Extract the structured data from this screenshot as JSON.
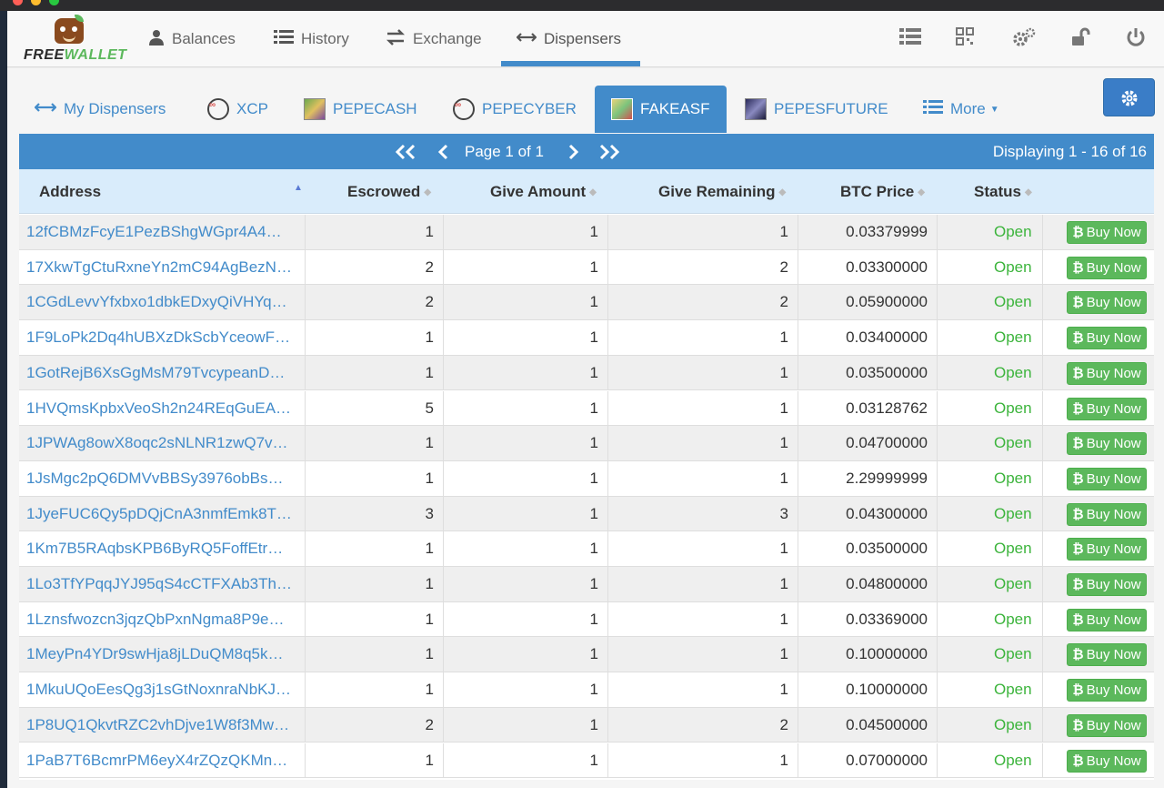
{
  "nav": {
    "logo_text_1": "FREE",
    "logo_text_2": "WALLET",
    "items": [
      {
        "label": "Balances",
        "icon": "user-icon"
      },
      {
        "label": "History",
        "icon": "list-icon"
      },
      {
        "label": "Exchange",
        "icon": "exchange-icon"
      },
      {
        "label": "Dispensers",
        "icon": "arrows-horizontal-icon"
      }
    ],
    "right_icons": [
      "list-icon",
      "qrcode-icon",
      "gears-icon",
      "unlock-icon",
      "power-icon"
    ]
  },
  "tabs": [
    {
      "label": "My Dispensers",
      "icon": "arrows-horizontal-icon"
    },
    {
      "label": "XCP",
      "icon": "xcp-token-icon"
    },
    {
      "label": "PEPECASH",
      "icon": "pepecash-token-icon"
    },
    {
      "label": "PEPECYBER",
      "icon": "pepecyber-token-icon"
    },
    {
      "label": "FAKEASF",
      "icon": "fakeasf-token-icon"
    },
    {
      "label": "PEPESFUTURE",
      "icon": "pepesfuture-token-icon"
    },
    {
      "label": "More",
      "icon": "list-icon"
    }
  ],
  "pager": {
    "page_text": "Page 1 of 1",
    "display_text": "Displaying 1 - 16 of 16"
  },
  "columns": [
    "Address",
    "Escrowed",
    "Give Amount",
    "Give Remaining",
    "BTC Price",
    "Status"
  ],
  "buy_label": "Buy Now",
  "rows": [
    {
      "address": "12fCBMzFcyE1PezBShgWGpr4A4…",
      "escrowed": "1",
      "give_amount": "1",
      "give_remaining": "1",
      "btc_price": "0.03379999",
      "status": "Open"
    },
    {
      "address": "17XkwTgCtuRxneYn2mC94AgBezN…",
      "escrowed": "2",
      "give_amount": "1",
      "give_remaining": "2",
      "btc_price": "0.03300000",
      "status": "Open"
    },
    {
      "address": "1CGdLevvYfxbxo1dbkEDxyQiVHYq…",
      "escrowed": "2",
      "give_amount": "1",
      "give_remaining": "2",
      "btc_price": "0.05900000",
      "status": "Open"
    },
    {
      "address": "1F9LoPk2Dq4hUBXzDkScbYceowF…",
      "escrowed": "1",
      "give_amount": "1",
      "give_remaining": "1",
      "btc_price": "0.03400000",
      "status": "Open"
    },
    {
      "address": "1GotRejB6XsGgMsM79TvcypeanD…",
      "escrowed": "1",
      "give_amount": "1",
      "give_remaining": "1",
      "btc_price": "0.03500000",
      "status": "Open"
    },
    {
      "address": "1HVQmsKpbxVeoSh2n24REqGuEA…",
      "escrowed": "5",
      "give_amount": "1",
      "give_remaining": "1",
      "btc_price": "0.03128762",
      "status": "Open"
    },
    {
      "address": "1JPWAg8owX8oqc2sNLNR1zwQ7v…",
      "escrowed": "1",
      "give_amount": "1",
      "give_remaining": "1",
      "btc_price": "0.04700000",
      "status": "Open"
    },
    {
      "address": "1JsMgc2pQ6DMVvBBSy3976obBs…",
      "escrowed": "1",
      "give_amount": "1",
      "give_remaining": "1",
      "btc_price": "2.29999999",
      "status": "Open"
    },
    {
      "address": "1JyeFUC6Qy5pDQjCnA3nmfEmk8T…",
      "escrowed": "3",
      "give_amount": "1",
      "give_remaining": "3",
      "btc_price": "0.04300000",
      "status": "Open"
    },
    {
      "address": "1Km7B5RAqbsKPB6ByRQ5FoffEtr…",
      "escrowed": "1",
      "give_amount": "1",
      "give_remaining": "1",
      "btc_price": "0.03500000",
      "status": "Open"
    },
    {
      "address": "1Lo3TfYPqqJYJ95qS4cCTFXAb3Th…",
      "escrowed": "1",
      "give_amount": "1",
      "give_remaining": "1",
      "btc_price": "0.04800000",
      "status": "Open"
    },
    {
      "address": "1Lznsfwozcn3jqzQbPxnNgma8P9e…",
      "escrowed": "1",
      "give_amount": "1",
      "give_remaining": "1",
      "btc_price": "0.03369000",
      "status": "Open"
    },
    {
      "address": "1MeyPn4YDr9swHja8jLDuQM8q5k…",
      "escrowed": "1",
      "give_amount": "1",
      "give_remaining": "1",
      "btc_price": "0.10000000",
      "status": "Open"
    },
    {
      "address": "1MkuUQoEesQg3j1sGtNoxnraNbKJ…",
      "escrowed": "1",
      "give_amount": "1",
      "give_remaining": "1",
      "btc_price": "0.10000000",
      "status": "Open"
    },
    {
      "address": "1P8UQ1QkvtRZC2vhDjve1W8f3Mw…",
      "escrowed": "2",
      "give_amount": "1",
      "give_remaining": "2",
      "btc_price": "0.04500000",
      "status": "Open"
    },
    {
      "address": "1PaB7T6BcmrPM6eyX4rZQzQKMn…",
      "escrowed": "1",
      "give_amount": "1",
      "give_remaining": "1",
      "btc_price": "0.07000000",
      "status": "Open"
    }
  ],
  "colors": {
    "primary": "#428bca",
    "success": "#5cb85c",
    "status_open": "#3cb43c",
    "header_bg": "#d9ecfb"
  }
}
